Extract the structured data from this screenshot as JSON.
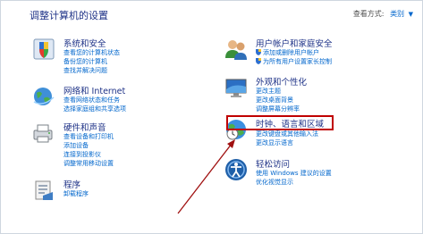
{
  "page": {
    "title": "调整计算机的设置",
    "view_by_label": "查看方式:",
    "view_by_value": "类别"
  },
  "categories_left": [
    {
      "name": "系统和安全",
      "icon": "system-security-icon",
      "links": [
        "查看您的计算机状态",
        "备份您的计算机",
        "查找并解决问题"
      ]
    },
    {
      "name": "网络和 Internet",
      "icon": "network-internet-icon",
      "links": [
        "查看网络状态和任务",
        "选择家庭组和共享选项"
      ]
    },
    {
      "name": "硬件和声音",
      "icon": "hardware-sound-icon",
      "links": [
        "查看设备和打印机",
        "添加设备",
        "连接到投影仪",
        "调整常用移动设置"
      ]
    },
    {
      "name": "程序",
      "icon": "programs-icon",
      "links": [
        "卸载程序"
      ]
    }
  ],
  "categories_right": [
    {
      "name": "用户帐户和家庭安全",
      "icon": "user-accounts-icon",
      "links": [
        "添加或删除用户帐户",
        "为所有用户设置家长控制"
      ]
    },
    {
      "name": "外观和个性化",
      "icon": "appearance-icon",
      "links": [
        "更改主题",
        "更改桌面背景",
        "调整屏幕分辨率"
      ]
    },
    {
      "name": "时钟、语言和区域",
      "icon": "clock-language-region-icon",
      "links": [
        "更改键盘或其他输入法",
        "更改显示语言"
      ]
    },
    {
      "name": "轻松访问",
      "icon": "ease-of-access-icon",
      "links": [
        "使用 Windows 建议的设置",
        "优化视觉显示"
      ]
    }
  ],
  "colors": {
    "heading": "#1e3287",
    "link": "#0066cc",
    "highlight": "#c00000",
    "annotation_arrow": "#a01010"
  }
}
